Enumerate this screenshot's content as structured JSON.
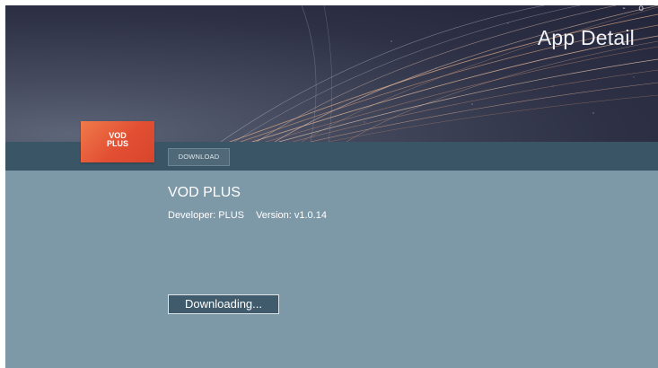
{
  "header": {
    "title": "App Detail",
    "window_controls": "- o"
  },
  "app": {
    "icon_text": "VOD\nPLUS",
    "name": "VOD PLUS",
    "developer": "Developer: PLUS",
    "version": "Version: v1.0.14"
  },
  "tabs": [
    {
      "label": "DOWNLOAD"
    }
  ],
  "actions": {
    "status_label": "Downloading..."
  },
  "colors": {
    "content_background": "#7d98a7",
    "tab_bar": "#3a5566",
    "icon_accent": "#e24f33"
  }
}
